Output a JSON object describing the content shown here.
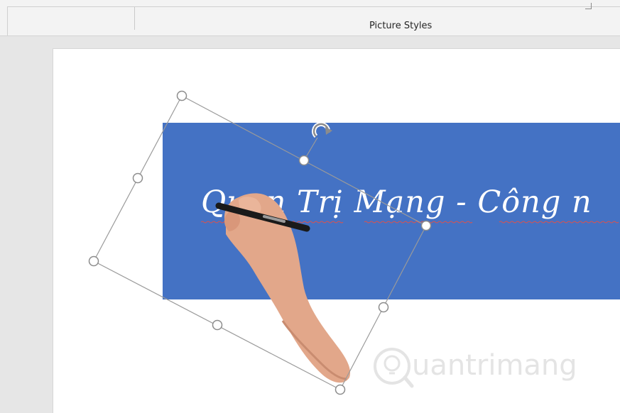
{
  "ribbon": {
    "group_label": "Picture Styles"
  },
  "slide": {
    "banner_text": "Quan Trị Mạng - Công n",
    "banner_color": "#4472c4",
    "watermark": "uantrimang"
  },
  "icons": {
    "rotate_handle": "rotate-icon",
    "dialog_launcher": "dialog-launcher-icon",
    "watermark_logo": "bulb-logo-icon"
  }
}
